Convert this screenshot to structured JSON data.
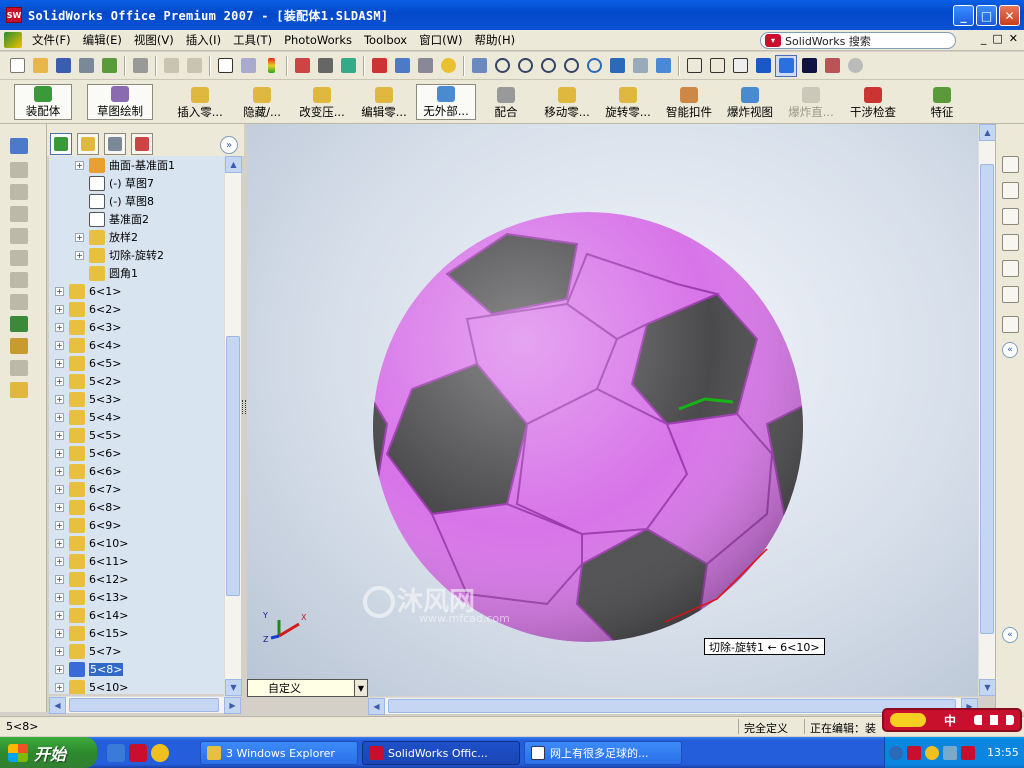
{
  "window": {
    "title": "SolidWorks Office Premium 2007 - [装配体1.SLDASM]",
    "buttons": [
      "_",
      "□",
      "✕"
    ]
  },
  "menu": {
    "items": [
      "文件(F)",
      "编辑(E)",
      "视图(V)",
      "插入(I)",
      "工具(T)",
      "PhotoWorks",
      "Toolbox",
      "窗口(W)",
      "帮助(H)"
    ],
    "search_label": "SolidWorks 搜索",
    "doc_buttons": [
      "_",
      "□",
      "✕"
    ]
  },
  "command_manager": {
    "items": [
      "装配体",
      "草图绘制",
      "插入零...",
      "隐藏/...",
      "改变压...",
      "编辑零...",
      "无外部...",
      "配合",
      "移动零...",
      "旋转零...",
      "智能扣件",
      "爆炸视图",
      "爆炸直...",
      "干涉检查",
      "特征"
    ]
  },
  "tree": {
    "items": [
      {
        "label": "曲面-基准面1",
        "expandable": true,
        "icon": "surface-plane-icon"
      },
      {
        "label": "(-) 草图7",
        "expandable": false,
        "icon": "sketch-icon"
      },
      {
        "label": "(-) 草图8",
        "expandable": false,
        "icon": "sketch-icon"
      },
      {
        "label": "基准面2",
        "expandable": false,
        "icon": "plane-icon"
      },
      {
        "label": "放样2",
        "expandable": true,
        "icon": "loft-icon"
      },
      {
        "label": "切除-旋转2",
        "expandable": true,
        "icon": "cut-revolve-icon"
      },
      {
        "label": "圆角1",
        "expandable": false,
        "icon": "fillet-icon"
      },
      {
        "label": "6<1>",
        "expandable": true,
        "icon": "part-icon"
      },
      {
        "label": "6<2>",
        "expandable": true,
        "icon": "part-icon"
      },
      {
        "label": "6<3>",
        "expandable": true,
        "icon": "part-icon"
      },
      {
        "label": "6<4>",
        "expandable": true,
        "icon": "part-icon"
      },
      {
        "label": "6<5>",
        "expandable": true,
        "icon": "part-icon"
      },
      {
        "label": "5<2>",
        "expandable": true,
        "icon": "part-icon"
      },
      {
        "label": "5<3>",
        "expandable": true,
        "icon": "part-icon"
      },
      {
        "label": "5<4>",
        "expandable": true,
        "icon": "part-icon"
      },
      {
        "label": "5<5>",
        "expandable": true,
        "icon": "part-icon"
      },
      {
        "label": "5<6>",
        "expandable": true,
        "icon": "part-icon"
      },
      {
        "label": "6<6>",
        "expandable": true,
        "icon": "part-icon"
      },
      {
        "label": "6<7>",
        "expandable": true,
        "icon": "part-icon"
      },
      {
        "label": "6<8>",
        "expandable": true,
        "icon": "part-icon"
      },
      {
        "label": "6<9>",
        "expandable": true,
        "icon": "part-icon"
      },
      {
        "label": "6<10>",
        "expandable": true,
        "icon": "part-icon"
      },
      {
        "label": "6<11>",
        "expandable": true,
        "icon": "part-icon"
      },
      {
        "label": "6<12>",
        "expandable": true,
        "icon": "part-icon"
      },
      {
        "label": "6<13>",
        "expandable": true,
        "icon": "part-icon"
      },
      {
        "label": "6<14>",
        "expandable": true,
        "icon": "part-icon"
      },
      {
        "label": "6<15>",
        "expandable": true,
        "icon": "part-icon"
      },
      {
        "label": "5<7>",
        "expandable": true,
        "icon": "part-icon"
      },
      {
        "label": "5<8>",
        "expandable": true,
        "icon": "part-icon",
        "selected": true
      },
      {
        "label": "5<10>",
        "expandable": true,
        "icon": "part-icon"
      }
    ]
  },
  "viewport": {
    "configuration": "自定义",
    "tooltip": "切除-旋转1 ← 6<10>",
    "watermark_text": "沐风网",
    "watermark_url": "www.mfcad.com",
    "axis_labels": {
      "x": "X",
      "y": "Y",
      "z": "Z"
    },
    "ball_color_light": "#d774e8",
    "ball_color_dark": "#4a4a4c"
  },
  "status": {
    "left": "5<8>",
    "mid": "完全定义",
    "right": "正在编辑：装"
  },
  "ime": {
    "label": "中"
  },
  "taskbar": {
    "start": "开始",
    "tasks": [
      "3 Windows Explorer",
      "SolidWorks Offic...",
      "网上有很多足球的..."
    ],
    "clock": "13:55"
  }
}
